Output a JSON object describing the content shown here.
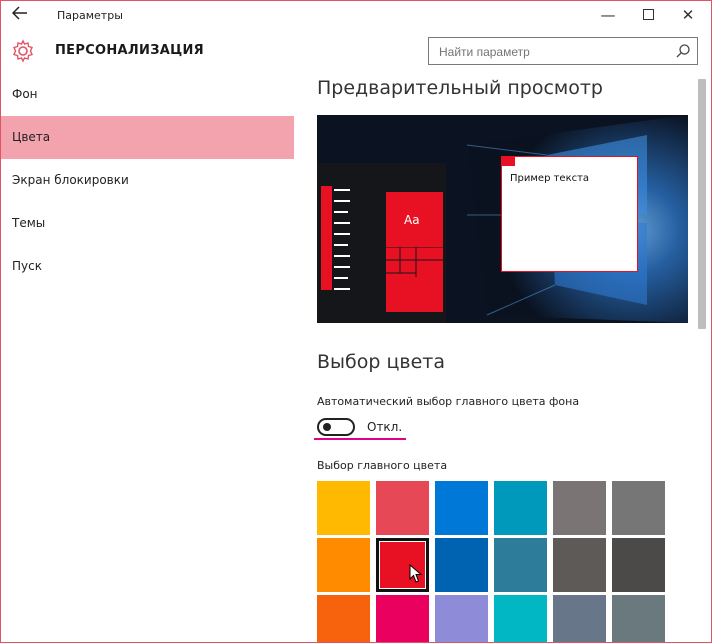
{
  "window": {
    "title": "Параметры",
    "controls": {
      "minimize": "—",
      "close": "✕"
    }
  },
  "header": {
    "title": "ПЕРСОНАЛИЗАЦИЯ",
    "icon": "gear-icon"
  },
  "search": {
    "placeholder": "Найти параметр",
    "value": ""
  },
  "sidebar": {
    "items": [
      {
        "label": "Фон",
        "active": false
      },
      {
        "label": "Цвета",
        "active": true
      },
      {
        "label": "Экран блокировки",
        "active": false
      },
      {
        "label": "Темы",
        "active": false
      },
      {
        "label": "Пуск",
        "active": false
      }
    ]
  },
  "preview": {
    "heading": "Предварительный просмотр",
    "tile_label": "Aa",
    "sample_text": "Пример текста"
  },
  "color_choice": {
    "heading": "Выбор цвета",
    "auto_label": "Автоматический выбор главного цвета фона",
    "toggle_state": "Откл.",
    "toggle_on": false,
    "main_color_label": "Выбор главного цвета",
    "selected_color": "#e81123",
    "swatches": [
      [
        "#ffb900",
        "#e74856",
        "#0078d7",
        "#0099bc",
        "#7a7574",
        "#767676"
      ],
      [
        "#ff8c00",
        "#e81123",
        "#0063b1",
        "#2d7d9a",
        "#5d5a58",
        "#4c4a48"
      ],
      [
        "#f7630c",
        "#ea005e",
        "#8e8cd8",
        "#00b7c3",
        "#68768a",
        "#69797e"
      ]
    ]
  },
  "colors": {
    "accent": "#e81123",
    "sidebar_active": "#f2a3ae",
    "brand_pink": "#e05565"
  }
}
